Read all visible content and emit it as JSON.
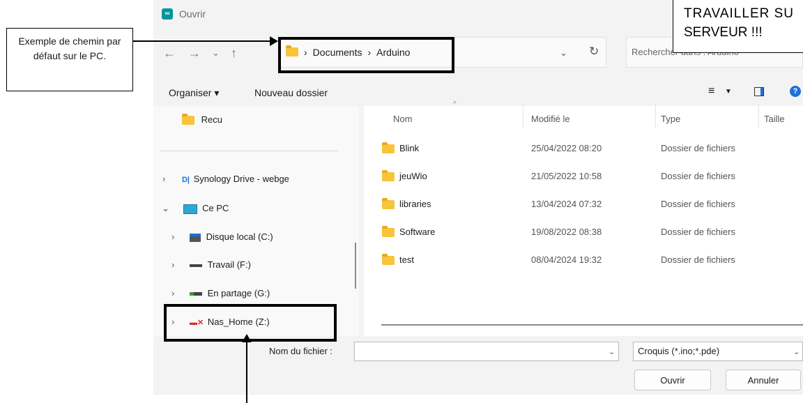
{
  "window": {
    "title": "Ouvrir",
    "app_icon": "arduino-icon"
  },
  "address_bar": {
    "breadcrumb": [
      "Documents",
      "Arduino"
    ],
    "separator": "›",
    "search_placeholder": "Rechercher dans : Arduino"
  },
  "toolbar": {
    "organise_label": "Organiser ▾",
    "new_folder_label": "Nouveau dossier"
  },
  "nav_pane": {
    "items": [
      {
        "label": "Recu",
        "icon": "folder-icon"
      },
      {
        "label": "Synology Drive - webge",
        "icon": "synology-icon",
        "expander": "›"
      },
      {
        "label": "Ce PC",
        "icon": "computer-icon",
        "expander": "⌄"
      },
      {
        "label": "Disque local (C:)",
        "icon": "windows-drive-icon",
        "expander": "›"
      },
      {
        "label": "Travail (F:)",
        "icon": "drive-icon",
        "expander": "›"
      },
      {
        "label": "En partage (G:)",
        "icon": "network-drive-icon",
        "expander": "›"
      },
      {
        "label": "Nas_Home (Z:)",
        "icon": "disconnected-drive-icon",
        "expander": "›"
      }
    ]
  },
  "file_list": {
    "columns": [
      "Nom",
      "Modifié le",
      "Type",
      "Taille"
    ],
    "rows": [
      {
        "name": "Blink",
        "modified": "25/04/2022 08:20",
        "type": "Dossier de fichiers"
      },
      {
        "name": "jeuWio",
        "modified": "21/05/2022 10:58",
        "type": "Dossier de fichiers"
      },
      {
        "name": "libraries",
        "modified": "13/04/2024 07:32",
        "type": "Dossier de fichiers"
      },
      {
        "name": "Software",
        "modified": "19/08/2022 08:38",
        "type": "Dossier de fichiers"
      },
      {
        "name": "test",
        "modified": "08/04/2024 19:32",
        "type": "Dossier de fichiers"
      }
    ]
  },
  "bottom": {
    "filename_label": "Nom du fichier :",
    "filename_value": "",
    "filter_value": "Croquis (*.ino;*.pde)",
    "open_label": "Ouvrir",
    "cancel_label": "Annuler"
  },
  "annotations": {
    "callout_text": "Exemple de chemin par défaut sur le PC.",
    "warning_line1": "TRAVAILLER SU",
    "warning_line2": "SERVEUR !!!"
  },
  "colors": {
    "folder": "#f8c43a",
    "accent": "#1e6fd9",
    "dialog_bg": "#f3f3f3"
  }
}
